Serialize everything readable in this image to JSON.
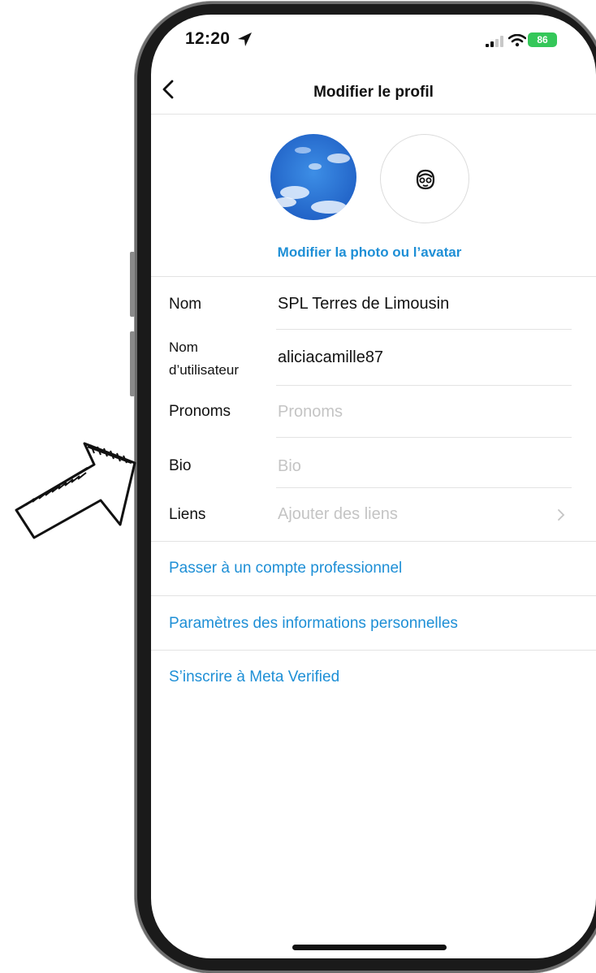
{
  "status_bar": {
    "time": "12:20",
    "battery": "86"
  },
  "nav": {
    "title": "Modifier le profil"
  },
  "profile": {
    "edit_photo_label": "Modifier la photo ou l’avatar"
  },
  "fields": {
    "nom": {
      "label": "Nom",
      "value": "SPL Terres de Limousin"
    },
    "username": {
      "label_line1": "Nom",
      "label_line2": "d’utilisateur",
      "value": "aliciacamille87"
    },
    "pronoms": {
      "label": "Pronoms",
      "placeholder": "Pronoms"
    },
    "bio": {
      "label": "Bio",
      "placeholder": "Bio"
    },
    "liens": {
      "label": "Liens",
      "placeholder": "Ajouter des liens"
    }
  },
  "links": {
    "pro": "Passer à un compte professionnel",
    "personal_info": "Paramètres des informations personnelles",
    "meta_verified": "S’inscrire à Meta Verified"
  },
  "colors": {
    "accent": "#1e8fd6",
    "battery": "#34c759",
    "placeholder": "#c4c4c4"
  },
  "icons": [
    "location-arrow-icon",
    "signal-icon",
    "wifi-icon",
    "battery-icon",
    "back-chevron-icon",
    "avatar-face-icon",
    "chevron-right-icon",
    "hand-drawn-arrow"
  ]
}
